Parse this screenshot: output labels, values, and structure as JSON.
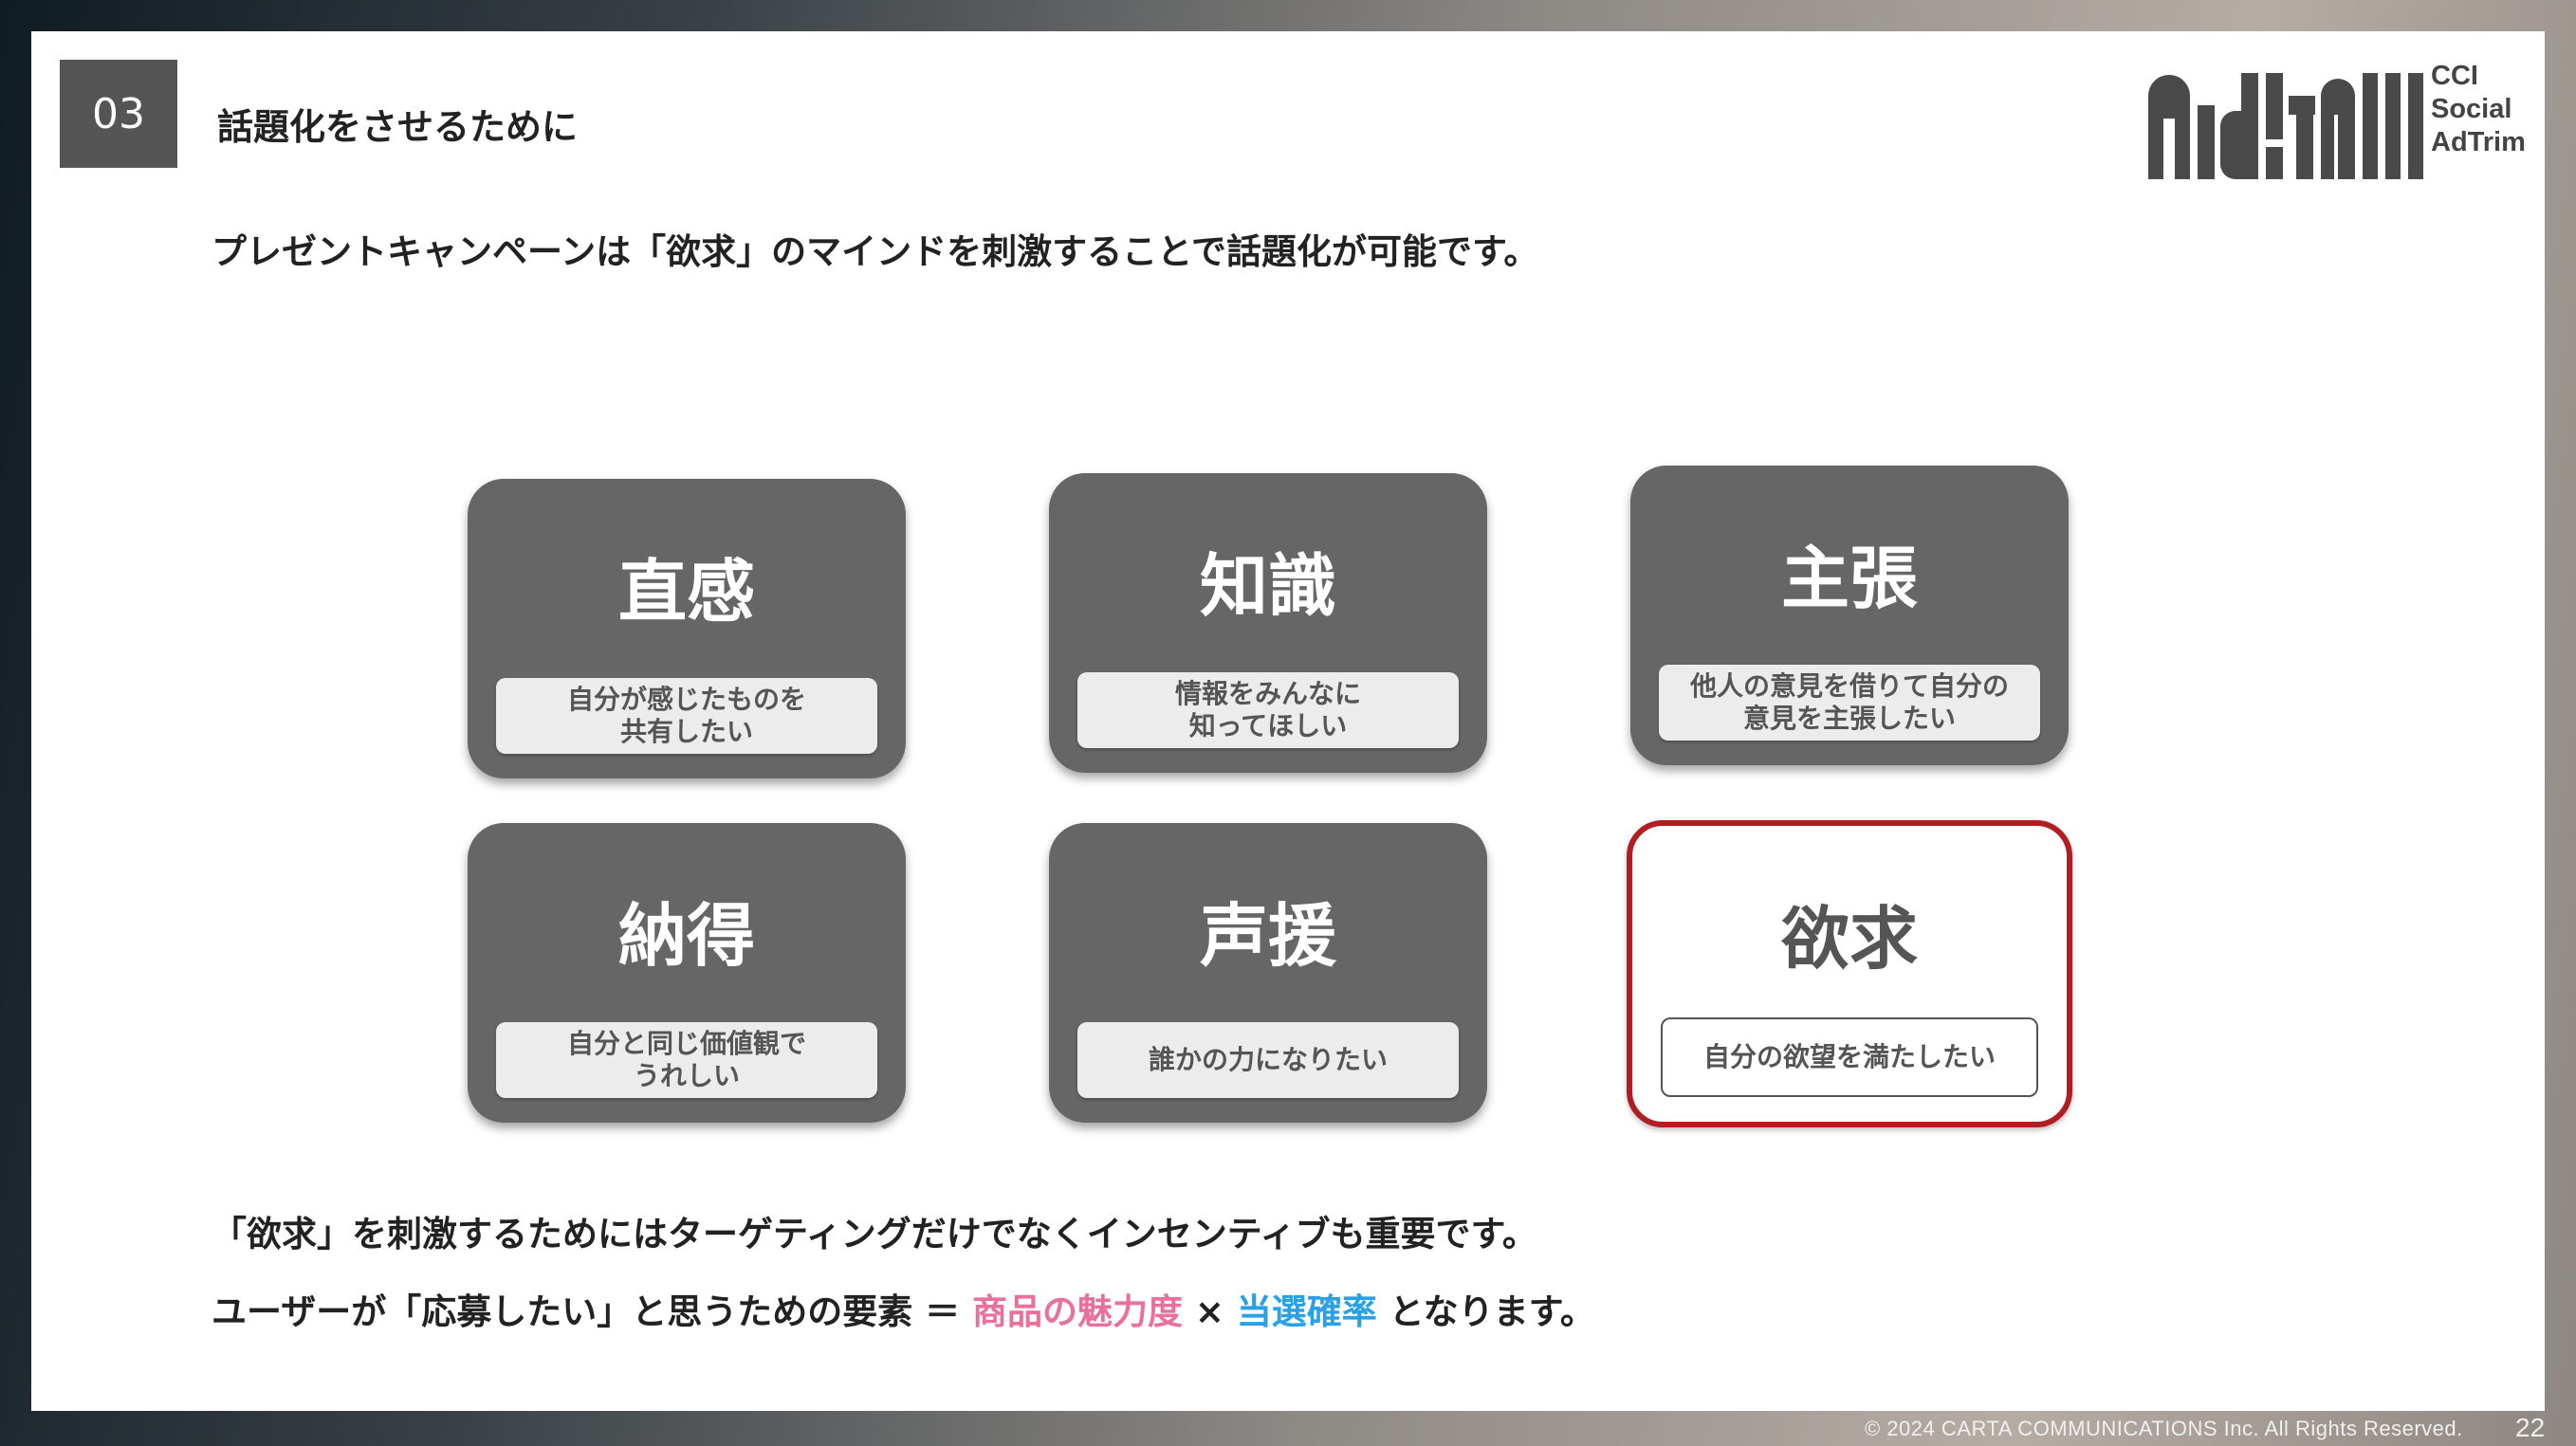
{
  "header": {
    "section_number": "03",
    "section_title": "話題化をさせるために"
  },
  "logo": {
    "line1": "CCI",
    "line2": "Social",
    "line3": "AdTrim"
  },
  "lead_text": "プレゼントキャンペーンは「欲求」のマインドを刺激することで話題化が可能です。",
  "cards": [
    {
      "title": "直感",
      "sub": "自分が感じたものを\n共有したい"
    },
    {
      "title": "知識",
      "sub": "情報をみんなに\n知ってほしい"
    },
    {
      "title": "主張",
      "sub": "他人の意見を借りて自分の\n意見を主張したい"
    },
    {
      "title": "納得",
      "sub": "自分と同じ価値観で\nうれしい"
    },
    {
      "title": "声援",
      "sub": "誰かの力になりたい"
    },
    {
      "title": "欲求",
      "sub": "自分の欲望を満たしたい"
    }
  ],
  "footer": {
    "line1": "「欲求」を刺激するためにはターゲティングだけでなくインセンティブも重要です。",
    "line2_prefix": "ユーザーが「応募したい」と思うための要素 ＝ ",
    "line2_pink": "商品の魅力度",
    "line2_times": " × ",
    "line2_blue": "当選確率",
    "line2_suffix": " となります。"
  },
  "colors": {
    "highlight_border": "#b01d22",
    "pink": "#e8709a",
    "blue": "#2aa0e6",
    "card_bg": "#666666"
  },
  "copyright": "© 2024 CARTA COMMUNICATIONS Inc.  All Rights Reserved.",
  "page_number": "22"
}
